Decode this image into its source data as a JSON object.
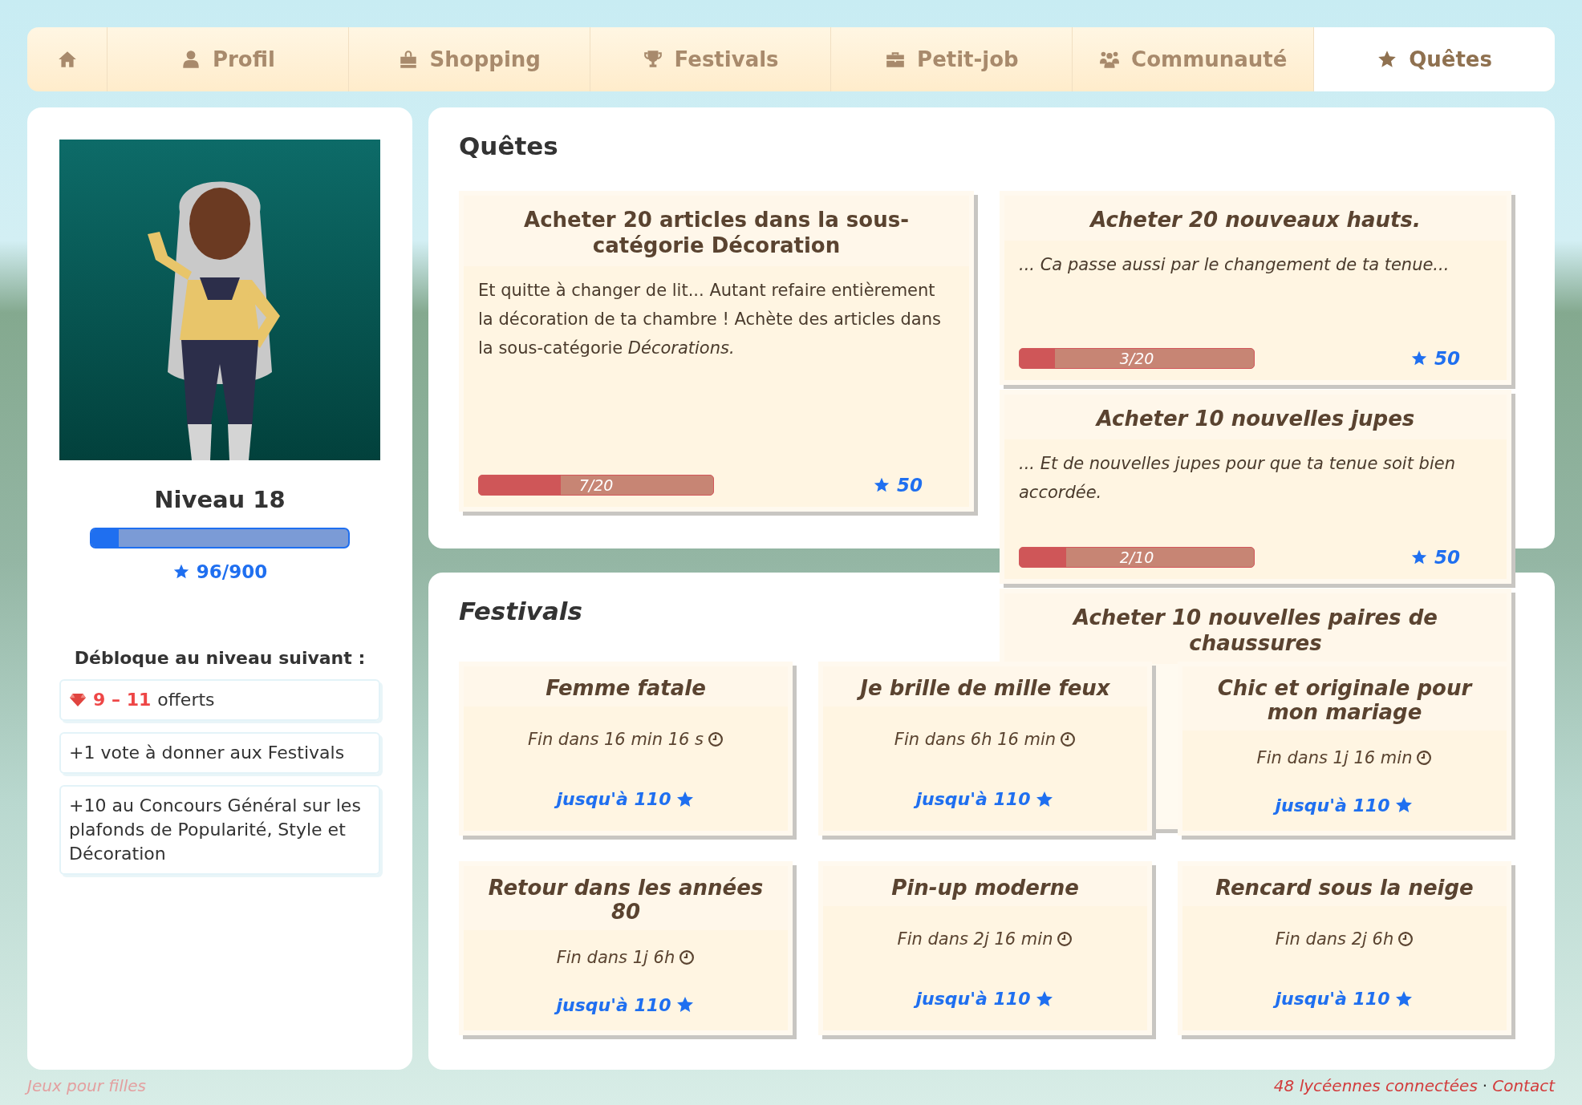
{
  "nav": {
    "tabs": [
      {
        "kind": "home",
        "selected": false
      },
      {
        "kind": "profile",
        "label": "Profil",
        "selected": false
      },
      {
        "kind": "shopping",
        "label": "Shopping",
        "selected": false
      },
      {
        "kind": "festivals",
        "label": "Festivals",
        "selected": false
      },
      {
        "kind": "job",
        "label": "Petit-job",
        "selected": false
      },
      {
        "kind": "community",
        "label": "Communauté",
        "selected": false
      },
      {
        "kind": "quests",
        "label": "Quêtes",
        "selected": true
      }
    ]
  },
  "profile": {
    "level_title": "Niveau 18",
    "xp": {
      "level": 0.107,
      "reading": "96/900"
    },
    "unlock_heading": "Débloque au niveau suivant :",
    "unlocks": [
      {
        "kind": "gems",
        "range": "9 – 11",
        "text": "offerts"
      },
      {
        "kind": "text",
        "text": "+1 vote à donner aux Festivals"
      },
      {
        "kind": "text",
        "text": "+10 au Concours Général sur les plafonds de Popularité, Style et Décoration"
      }
    ]
  },
  "quests": {
    "title": "Quêtes",
    "items": [
      {
        "title": "Acheter 20 articles dans la sous-catégorie Décoration",
        "italic": false,
        "description": "Et quitte à changer de lit... Autant refaire entièrement la décoration de ta chambre ! Achète des articles dans la sous-catégorie *Décorations.*",
        "progress": {
          "level": 0.35,
          "reading": "7/20"
        },
        "reward": "50"
      },
      {
        "title": "Acheter 20 nouveaux hauts.",
        "italic": true,
        "description": "... Ca passe aussi par le changement de ta tenue...",
        "progress": {
          "level": 0.15,
          "reading": "3/20"
        },
        "reward": "50"
      },
      {
        "title": "Acheter 10 nouvelles jupes",
        "italic": true,
        "description": "... Et de nouvelles jupes pour que ta tenue soit bien accordée.",
        "progress": {
          "level": 0.2,
          "reading": "2/10"
        },
        "reward": "50"
      },
      {
        "title": "Acheter 10 nouvelles paires de chaussures",
        "italic": true
      }
    ]
  },
  "festivals": {
    "title": "Festivals",
    "items": [
      {
        "title": "Femme fatale",
        "ends": "Fin dans 16 min 16 s",
        "reward": "jusqu'à 110"
      },
      {
        "title": "Je brille de mille feux",
        "ends": "Fin dans 6h 16 min",
        "reward": "jusqu'à 110"
      },
      {
        "title": "Chic et originale pour mon mariage",
        "ends": "Fin dans 1j 16 min",
        "reward": "jusqu'à 110"
      },
      {
        "title": "Retour dans les années 80",
        "ends": "Fin dans 1j 6h",
        "reward": "jusqu'à 110"
      },
      {
        "title": "Pin-up moderne",
        "ends": "Fin dans 2j 16 min",
        "reward": "jusqu'à 110"
      },
      {
        "title": "Rencard sous la neige",
        "ends": "Fin dans 2j 6h",
        "reward": "jusqu'à 110"
      }
    ]
  },
  "footer": {
    "left": "Jeux pour filles",
    "online": "48 lycéennes connectées",
    "separator": "·",
    "contact": "Contact"
  }
}
